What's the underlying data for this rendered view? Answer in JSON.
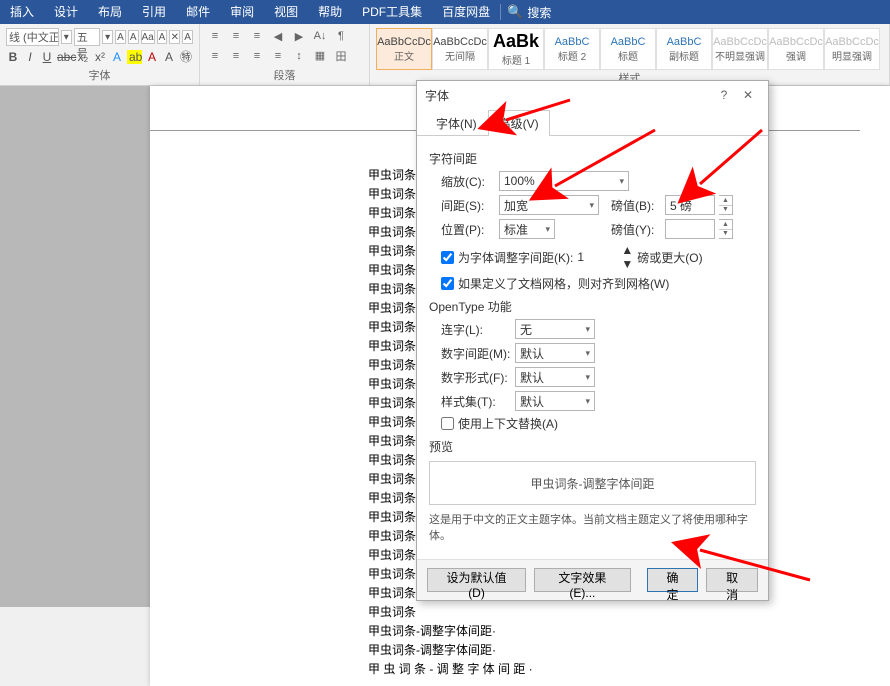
{
  "menu": {
    "tabs": [
      "插入",
      "设计",
      "布局",
      "引用",
      "邮件",
      "审阅",
      "视图",
      "帮助",
      "PDF工具集",
      "百度网盘"
    ],
    "search_label": "搜索"
  },
  "ribbon": {
    "font": {
      "name": "线 (中文正文",
      "size": "五号",
      "group_label": "字体",
      "buttons": [
        "B",
        "I",
        "U",
        "abc",
        "x₂",
        "x²"
      ]
    },
    "para": {
      "group_label": "段落"
    },
    "styles": {
      "group_label": "样式",
      "items": [
        {
          "preview": "AaBbCcDc",
          "name": "正文",
          "cls": ""
        },
        {
          "preview": "AaBbCcDc",
          "name": "无间隔",
          "cls": ""
        },
        {
          "preview": "AaBk",
          "name": "标题 1",
          "cls": "big"
        },
        {
          "preview": "AaBbC",
          "name": "标题 2",
          "cls": "blue"
        },
        {
          "preview": "AaBbC",
          "name": "标题",
          "cls": "blue"
        },
        {
          "preview": "AaBbC",
          "name": "副标题",
          "cls": "blue"
        },
        {
          "preview": "AaBbCcDc",
          "name": "不明显强调",
          "cls": "grey"
        },
        {
          "preview": "AaBbCcDc",
          "name": "强调",
          "cls": "grey"
        },
        {
          "preview": "AaBbCcDc",
          "name": "明显强调",
          "cls": "grey"
        }
      ]
    }
  },
  "doc": {
    "lines": [
      "甲虫词条",
      "甲虫词条",
      "甲虫词条",
      "甲虫词条",
      "甲虫词条",
      "甲虫词条",
      "甲虫词条",
      "甲虫词条",
      "甲虫词条",
      "甲虫词条",
      "甲虫词条",
      "甲虫词条",
      "甲虫词条",
      "甲虫词条",
      "甲虫词条",
      "甲虫词条",
      "甲虫词条",
      "甲虫词条",
      "甲虫词条",
      "甲虫词条",
      "甲虫词条",
      "甲虫词条",
      "甲虫词条",
      "甲虫词条",
      "甲虫词条-调整字体间距·",
      "甲虫词条-调整字体间距·",
      "甲 虫 词 条 - 调 整 字 体 间 距 ·"
    ]
  },
  "dialog": {
    "title": "字体",
    "tabs": {
      "font": "字体(N)",
      "advanced": "高级(V)"
    },
    "char_spacing": {
      "title": "字符间距",
      "scale_label": "缩放(C):",
      "scale_value": "100%",
      "spacing_label": "间距(S):",
      "spacing_value": "加宽",
      "spacing_by_label": "磅值(B):",
      "spacing_by_value": "5 磅",
      "position_label": "位置(P):",
      "position_value": "标准",
      "position_by_label": "磅值(Y):",
      "position_by_value": "",
      "kerning_chk": "为字体调整字间距(K):",
      "kerning_value": "1",
      "kerning_unit": "磅或更大(O)",
      "grid_chk": "如果定义了文档网格，则对齐到网格(W)"
    },
    "opentype": {
      "title": "OpenType 功能",
      "ligatures_label": "连字(L):",
      "ligatures_value": "无",
      "numspacing_label": "数字间距(M):",
      "numspacing_value": "默认",
      "numform_label": "数字形式(F):",
      "numform_value": "默认",
      "styleset_label": "样式集(T):",
      "styleset_value": "默认",
      "context_chk": "使用上下文替换(A)"
    },
    "preview": {
      "title": "预览",
      "sample": "甲虫词条-调整字体间距",
      "desc": "这是用于中文的正文主题字体。当前文档主题定义了将使用哪种字体。"
    },
    "footer": {
      "default": "设为默认值(D)",
      "effects": "文字效果(E)...",
      "ok": "确定",
      "cancel": "取消"
    }
  }
}
